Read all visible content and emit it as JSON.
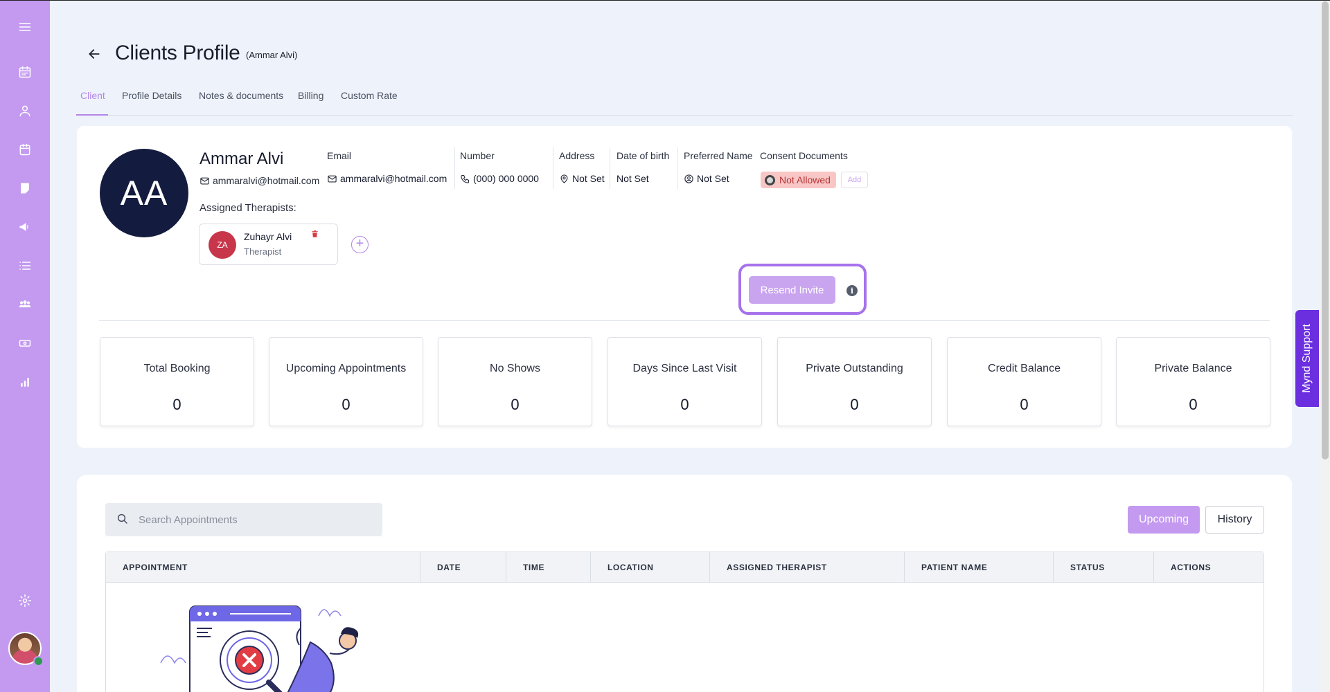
{
  "header": {
    "title": "Clients Profile",
    "subtitle": "(Ammar Alvi)"
  },
  "tabs": [
    {
      "label": "Client",
      "active": true
    },
    {
      "label": "Profile Details",
      "active": false
    },
    {
      "label": "Notes & documents",
      "active": false
    },
    {
      "label": "Billing",
      "active": false
    },
    {
      "label": "Custom Rate",
      "active": false
    }
  ],
  "client": {
    "initials": "AA",
    "name": "Ammar Alvi",
    "email": "ammaralvi@hotmail.com"
  },
  "info": {
    "email_label": "Email",
    "email_value": "ammaralvi@hotmail.com",
    "number_label": "Number",
    "number_value": "(000) 000 0000",
    "address_label": "Address",
    "address_value": "Not Set",
    "dob_label": "Date of birth",
    "dob_value": "Not Set",
    "preferred_label": "Preferred Name",
    "preferred_value": "Not Set",
    "consent_label": "Consent Documents",
    "consent_value": "Not Allowed",
    "consent_add": "Add"
  },
  "assigned": {
    "label": "Assigned Therapists:",
    "therapists": [
      {
        "initials": "ZA",
        "name": "Zuhayr Alvi",
        "role": "Therapist"
      }
    ]
  },
  "resend_invite": "Resend Invite",
  "info_icon": "i",
  "stats": [
    {
      "label": "Total Booking",
      "value": "0"
    },
    {
      "label": "Upcoming Appointments",
      "value": "0"
    },
    {
      "label": "No Shows",
      "value": "0"
    },
    {
      "label": "Days Since Last Visit",
      "value": "0"
    },
    {
      "label": "Private Outstanding",
      "value": "0"
    },
    {
      "label": "Credit Balance",
      "value": "0"
    },
    {
      "label": "Private Balance",
      "value": "0"
    }
  ],
  "appointments": {
    "search_placeholder": "Search Appointments",
    "toggle": {
      "upcoming": "Upcoming",
      "history": "History",
      "selected": "Upcoming"
    },
    "columns": [
      "APPOINTMENT",
      "DATE",
      "TIME",
      "LOCATION",
      "ASSIGNED THERAPIST",
      "PATIENT NAME",
      "STATUS",
      "ACTIONS"
    ]
  },
  "support_tab": "Mynd Support",
  "sidebar": {
    "icons": [
      "menu-icon",
      "calendar-icon",
      "user-icon",
      "calendar-check-icon",
      "note-icon",
      "megaphone-icon",
      "list-icon",
      "group-icon",
      "money-icon",
      "chart-icon",
      "settings-icon"
    ]
  },
  "colors": {
    "sidebar": "#c39af0",
    "accent": "#b385e8",
    "avatar_bg": "#131c3e",
    "therapist_avatar": "#c7364a",
    "consent_bg": "#f9c6c6",
    "support_tab": "#6b2fe0"
  }
}
